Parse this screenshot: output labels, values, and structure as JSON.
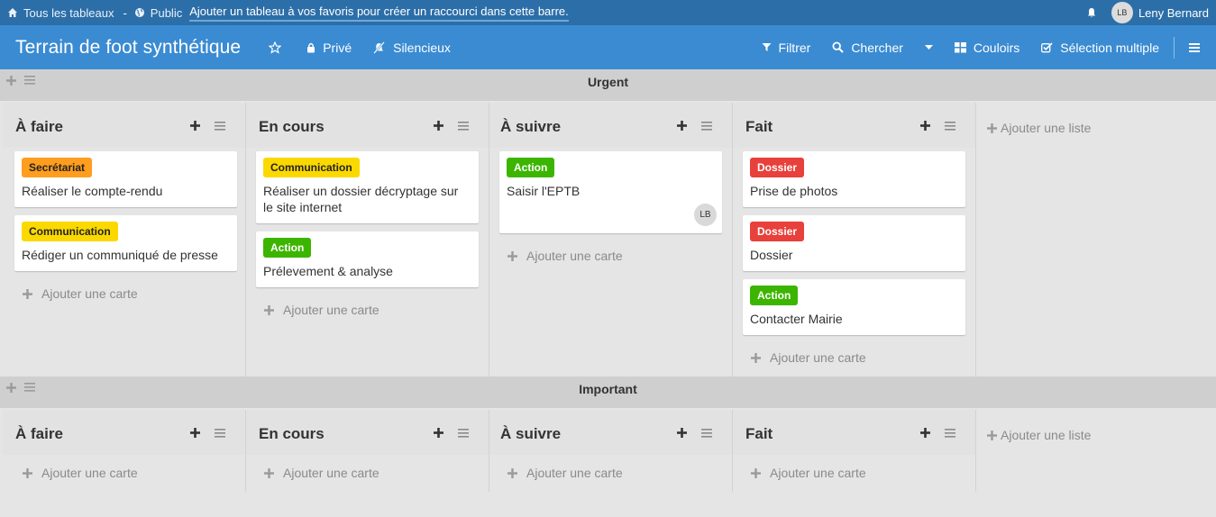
{
  "topbar": {
    "all_boards": "Tous les tableaux",
    "separator": "-",
    "visibility": "Public",
    "favorites_hint": "Ajouter un tableau à vos favoris pour créer un raccourci dans cette barre.",
    "user_initials": "LB",
    "user_name": "Leny Bernard"
  },
  "board": {
    "title": "Terrain de foot synthétique",
    "private_label": "Privé",
    "silent_label": "Silencieux",
    "filter_label": "Filtrer",
    "search_label": "Chercher",
    "swimlanes_label": "Couloirs",
    "multiselect_label": "Sélection multiple"
  },
  "colors": {
    "topbar": "#2c6ea8",
    "header": "#3a8bd2",
    "orange": "#ff9d1e",
    "yellow": "#fbd900",
    "green": "#3cb500",
    "red": "#e8403a"
  },
  "swimlanes": [
    {
      "title": "Urgent",
      "add_list": "Ajouter une liste",
      "lists": [
        {
          "title": "À faire",
          "add_card": "Ajouter une carte",
          "cards": [
            {
              "label": "Secrétariat",
              "label_color": "orange",
              "title": "Réaliser le compte-rendu"
            },
            {
              "label": "Communication",
              "label_color": "yellow",
              "title": "Rédiger un communiqué de presse"
            }
          ]
        },
        {
          "title": "En cours",
          "add_card": "Ajouter une carte",
          "cards": [
            {
              "label": "Communication",
              "label_color": "yellow",
              "title": "Réaliser un dossier décryptage sur le site internet"
            },
            {
              "label": "Action",
              "label_color": "green",
              "title": "Prélevement & analyse"
            }
          ]
        },
        {
          "title": "À suivre",
          "add_card": "Ajouter une carte",
          "cards": [
            {
              "label": "Action",
              "label_color": "green",
              "title": "Saisir l'EPTB",
              "member": "LB"
            }
          ]
        },
        {
          "title": "Fait",
          "add_card": "Ajouter une carte",
          "cards": [
            {
              "label": "Dossier",
              "label_color": "red",
              "title": "Prise de photos"
            },
            {
              "label": "Dossier",
              "label_color": "red",
              "title": "Dossier"
            },
            {
              "label": "Action",
              "label_color": "green",
              "title": "Contacter Mairie"
            }
          ]
        }
      ]
    },
    {
      "title": "Important",
      "add_list": "Ajouter une liste",
      "lists": [
        {
          "title": "À faire",
          "add_card": "Ajouter une carte",
          "cards": []
        },
        {
          "title": "En cours",
          "add_card": "Ajouter une carte",
          "cards": []
        },
        {
          "title": "À suivre",
          "add_card": "Ajouter une carte",
          "cards": []
        },
        {
          "title": "Fait",
          "add_card": "Ajouter une carte",
          "cards": []
        }
      ]
    }
  ]
}
